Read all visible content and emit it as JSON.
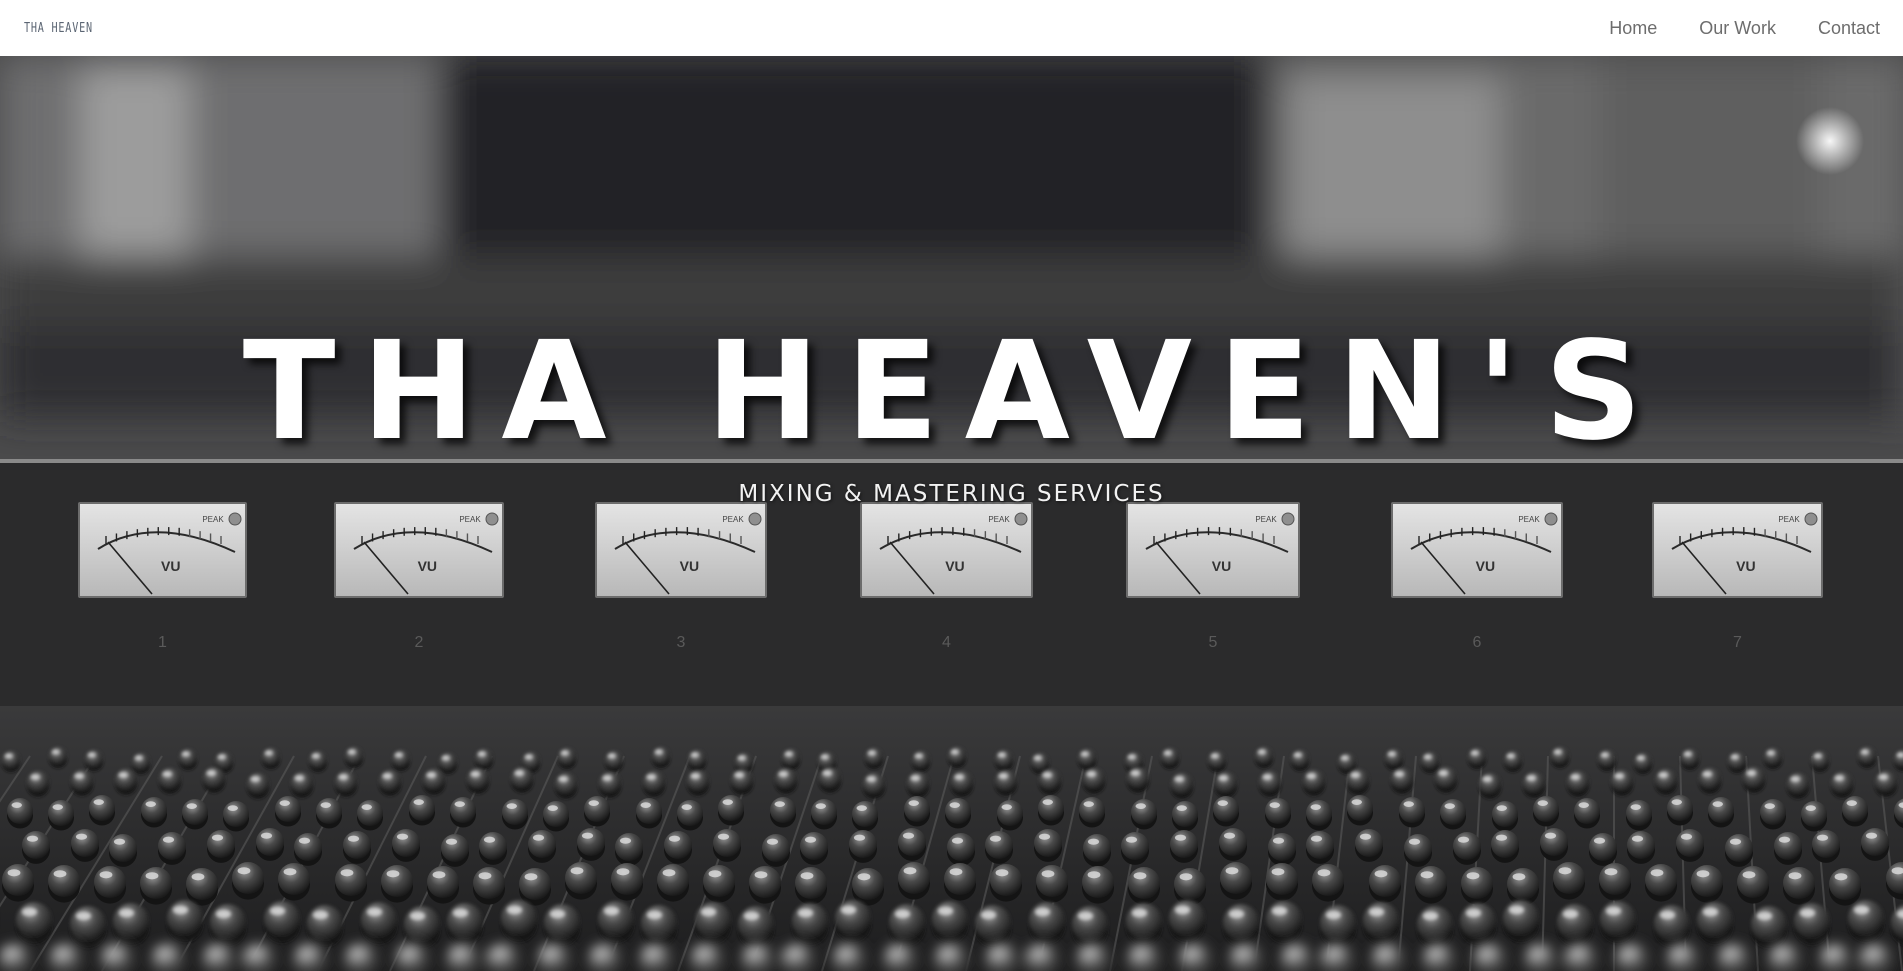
{
  "nav": {
    "logo": "THA HEAVEN",
    "links": [
      {
        "label": "Home"
      },
      {
        "label": "Our Work"
      },
      {
        "label": "Contact"
      }
    ]
  },
  "hero": {
    "title": "THA HEAVEN'S",
    "subtitle": "MIXING & MASTERING SERVICES",
    "background": "mixing-console-photo",
    "meters": [
      {
        "label": "VU",
        "peak": "PEAK",
        "channel": "1"
      },
      {
        "label": "VU",
        "peak": "PEAK",
        "channel": "2"
      },
      {
        "label": "VU",
        "peak": "PEAK",
        "channel": "3"
      },
      {
        "label": "VU",
        "peak": "PEAK",
        "channel": "4"
      },
      {
        "label": "VU",
        "peak": "PEAK",
        "channel": "5"
      },
      {
        "label": "VU",
        "peak": "PEAK",
        "channel": "6"
      },
      {
        "label": "VU",
        "peak": "PEAK",
        "channel": "7"
      }
    ]
  },
  "colors": {
    "navbar_bg": "#ffffff",
    "nav_text": "#6d6d6d",
    "logo_text": "#5b6573",
    "title_text": "#ffffff"
  }
}
